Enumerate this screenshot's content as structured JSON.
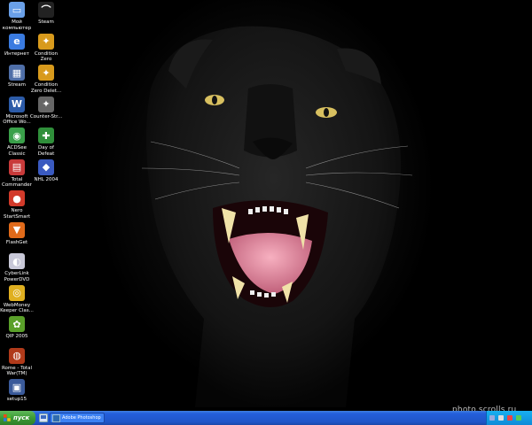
{
  "desktop": {
    "icons": [
      {
        "id": "my-computer",
        "label": "Мой компьютер",
        "glyph": "▭",
        "color": "#6aa0e8"
      },
      {
        "id": "steam",
        "label": "Steam",
        "glyph": "⌒",
        "color": "#222"
      },
      {
        "id": "internet",
        "label": "Интернет",
        "glyph": "e",
        "color": "#3a7be0"
      },
      {
        "id": "condition-zero",
        "label": "Condition Zero",
        "glyph": "✦",
        "color": "#d89a1c"
      },
      {
        "id": "stream",
        "label": "Stream",
        "glyph": "▦",
        "color": "#4f6fa8"
      },
      {
        "id": "condition-zero-deleted",
        "label": "Condition Zero Delet...",
        "glyph": "✦",
        "color": "#d89a1c"
      },
      {
        "id": "microsoft-office",
        "label": "Microsoft Office Wo...",
        "glyph": "W",
        "color": "#2c5ba8"
      },
      {
        "id": "counter-strike",
        "label": "Counter-Str...",
        "glyph": "✦",
        "color": "#666"
      },
      {
        "id": "acdsee",
        "label": "ACDSee Classic",
        "glyph": "◉",
        "color": "#3aa04a"
      },
      {
        "id": "day-of-defeat",
        "label": "Day of Defeat",
        "glyph": "✚",
        "color": "#2f8f3a"
      },
      {
        "id": "total-commander",
        "label": "Total Commander",
        "glyph": "▤",
        "color": "#c83a3a"
      },
      {
        "id": "nhl-2004",
        "label": "NHL 2004",
        "glyph": "◆",
        "color": "#3a5ac0"
      },
      {
        "id": "nero",
        "label": "Nero StartSmart",
        "glyph": "●",
        "color": "#d23a2a"
      },
      {
        "id": "flashget",
        "label": "FlashGet",
        "glyph": "▼",
        "color": "#e06a1a"
      },
      {
        "id": "powerdvd",
        "label": "CyberLink PowerDVD",
        "glyph": "◐",
        "color": "#c8c8d8"
      },
      {
        "id": "webmoney",
        "label": "WebMoney Keeper Clas...",
        "glyph": "◎",
        "color": "#e0b020"
      },
      {
        "id": "qip",
        "label": "QIP 2005",
        "glyph": "✿",
        "color": "#5aa02a"
      },
      {
        "id": "rome-total-war",
        "label": "Rome - Total War(TM)",
        "glyph": "◍",
        "color": "#b03a1a"
      },
      {
        "id": "setup15",
        "label": "setup15",
        "glyph": "▣",
        "color": "#3a5a9a"
      }
    ]
  },
  "taskbar": {
    "start_label": "пуск",
    "task_label": "Adobe Photoshop"
  },
  "watermark": "photo.scrolls.ru"
}
